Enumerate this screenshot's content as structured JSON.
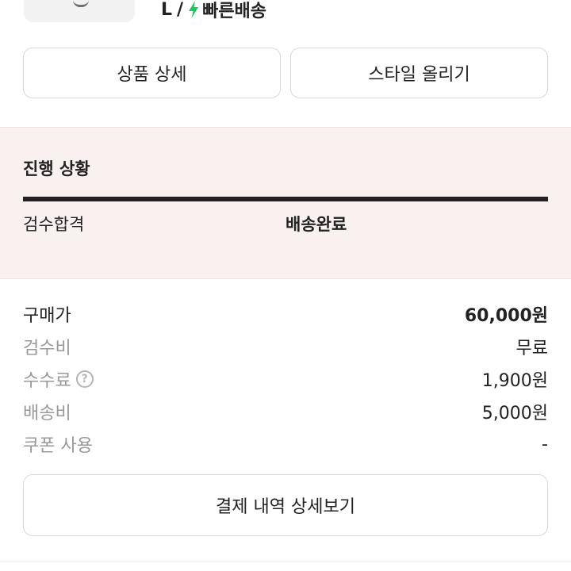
{
  "product": {
    "size": "L",
    "separator": "/",
    "delivery_label": "빠른배송",
    "bolt_color": "#22c55e"
  },
  "buttons": {
    "product_detail": "상품 상세",
    "post_style": "스타일 올리기",
    "payment_details": "결제 내역 상세보기"
  },
  "progress": {
    "title": "진행 상황",
    "steps": [
      "검수합격",
      "배송완료"
    ],
    "current_step": "배송완료",
    "background_color": "#f9f0f0"
  },
  "pricing": {
    "rows": [
      {
        "label": "구매가",
        "value": "60,000원"
      },
      {
        "label": "검수비",
        "value": "무료"
      },
      {
        "label": "수수료",
        "value": "1,900원",
        "help_icon": "?"
      },
      {
        "label": "배송비",
        "value": "5,000원"
      },
      {
        "label": "쿠폰 사용",
        "value": "-"
      }
    ]
  }
}
